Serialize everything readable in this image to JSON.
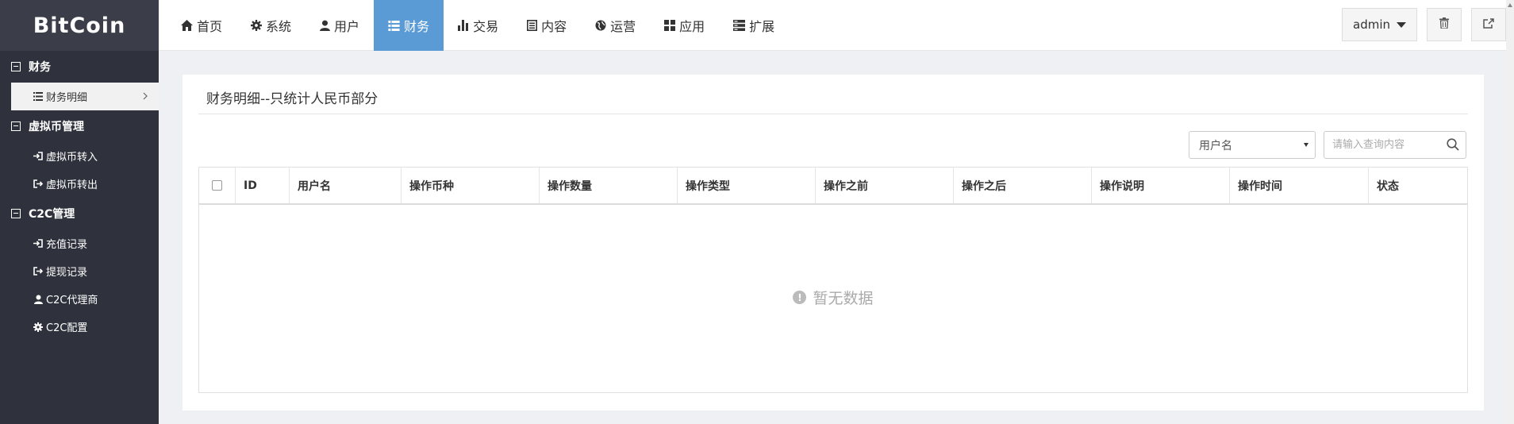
{
  "app": {
    "logo": "BitCoin"
  },
  "sidebar": {
    "groups": [
      {
        "label": "财务",
        "items": [
          {
            "label": "财务明细",
            "icon": "list-icon",
            "active": true
          }
        ]
      },
      {
        "label": "虚拟币管理",
        "items": [
          {
            "label": "虚拟币转入",
            "icon": "sign-in-icon"
          },
          {
            "label": "虚拟币转出",
            "icon": "sign-out-icon"
          }
        ]
      },
      {
        "label": "C2C管理",
        "items": [
          {
            "label": "充值记录",
            "icon": "sign-in-icon"
          },
          {
            "label": "提现记录",
            "icon": "sign-out-icon"
          },
          {
            "label": "C2C代理商",
            "icon": "user-icon"
          },
          {
            "label": "C2C配置",
            "icon": "gear-icon"
          }
        ]
      }
    ]
  },
  "nav": {
    "items": [
      {
        "label": "首页",
        "icon": "home-icon"
      },
      {
        "label": "系统",
        "icon": "gear-icon"
      },
      {
        "label": "用户",
        "icon": "user-icon"
      },
      {
        "label": "财务",
        "icon": "list-icon",
        "active": true
      },
      {
        "label": "交易",
        "icon": "bar-chart-icon"
      },
      {
        "label": "内容",
        "icon": "document-icon"
      },
      {
        "label": "运营",
        "icon": "globe-icon"
      },
      {
        "label": "应用",
        "icon": "grid-icon"
      },
      {
        "label": "扩展",
        "icon": "server-icon"
      }
    ],
    "user_label": "admin"
  },
  "panel": {
    "title": "财务明细--只统计人民币部分",
    "filter": {
      "selected": "用户名"
    },
    "search": {
      "placeholder": "请输入查询内容"
    },
    "columns": [
      "ID",
      "用户名",
      "操作币种",
      "操作数量",
      "操作类型",
      "操作之前",
      "操作之后",
      "操作说明",
      "操作时间",
      "状态"
    ],
    "rows": [],
    "empty_text": "暂无数据"
  },
  "colors": {
    "sidebar_bg": "#2f323c",
    "logo_bg": "#3b3e49",
    "accent": "#5b9bd5",
    "page_bg": "#eff0f4"
  }
}
